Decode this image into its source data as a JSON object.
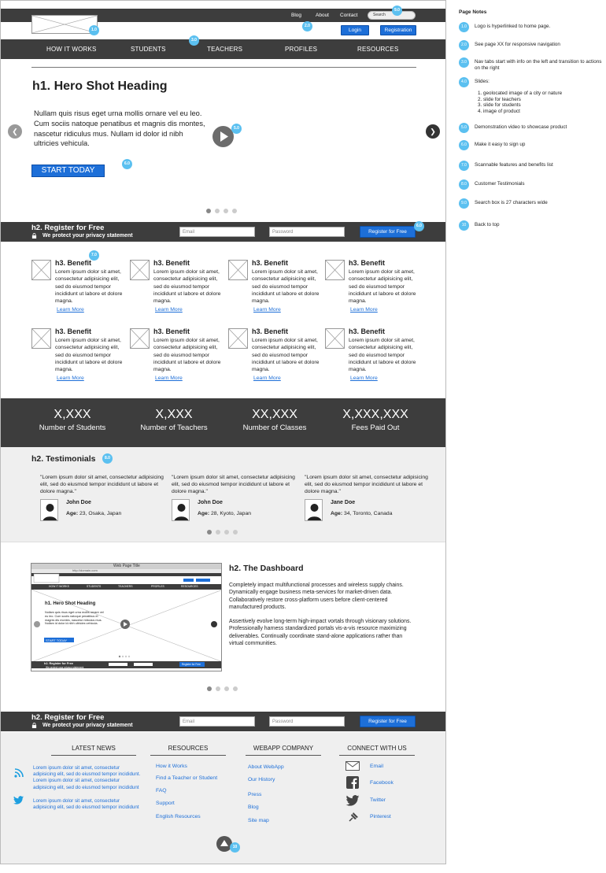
{
  "header": {
    "top_links": [
      "Blog",
      "About",
      "Contact"
    ],
    "search_placeholder": "Search",
    "login_label": "Login",
    "registration_label": "Registration",
    "nav_items": [
      "HOW IT WORKS",
      "STUDENTS",
      "TEACHERS",
      "PROFILES",
      "RESOURCES"
    ]
  },
  "badges": {
    "logo": "1.0",
    "search": "9.0",
    "nav": "3.0",
    "top": "2.0",
    "play": "5.0",
    "start": "6.0",
    "register": "6.0",
    "benefits": "7.0",
    "testimonials": "8.0",
    "backtop": "10"
  },
  "hero": {
    "heading": "h1. Hero Shot Heading",
    "body": "Nullam quis risus eget urna mollis ornare vel eu leo. Cum sociis natoque penatibus et magnis dis montes, nascetur ridiculus mus. Nullam id dolor id nibh ultricies vehicula.",
    "cta": "START TODAY"
  },
  "register": {
    "heading": "h2. Register for Free",
    "privacy": "We protect your privacy statement",
    "email_placeholder": "Email",
    "password_placeholder": "Password",
    "button": "Register for Free"
  },
  "benefits": {
    "title": "h3. Benefit",
    "text": "Lorem ipsum dolor sit amet, consectetur adipisicing elit, sed do eiusmod tempor incididunt ut labore et dolore magna.",
    "link": "Learn More"
  },
  "stats": [
    {
      "value": "X,XXX",
      "label": "Number of Students"
    },
    {
      "value": "X,XXX",
      "label": "Number of Teachers"
    },
    {
      "value": "XX,XXX",
      "label": "Number of Classes"
    },
    {
      "value": "X,XXX,XXX",
      "label": "Fees Paid Out"
    }
  ],
  "testimonials": {
    "heading": "h2. Testimonials",
    "quote": "\"Lorem ipsum dolor sit amet, consectetur adipisicing elit, sed do eiusmod tempor incididunt ut labore et dolore magna.\"",
    "people": [
      {
        "name": "John Doe",
        "age_label": "Age:",
        "age": "23, Osaka, Japan"
      },
      {
        "name": "John Doe",
        "age_label": "Age:",
        "age": "28, Kyoto, Japan"
      },
      {
        "name": "Jane Doe",
        "age_label": "Age:",
        "age": "34, Toronto, Canada"
      }
    ]
  },
  "dashboard": {
    "heading": "h2. The Dashboard",
    "p1": "Completely impact multifunctional processes and wireless supply chains. Dynamically engage business meta-services for market-driven data. Collaboratively restore cross-platform users before client-centered manufactured products.",
    "p2": "Assertively evolve long-term high-impact vortals through visionary solutions. Professionally harness standardized portals vis-a-vis resource maximizing deliverables. Continually coordinate stand-alone applications rather than virtual communities.",
    "mini_title": "Web Page Title",
    "mini_url": "http://domain.com",
    "mini_heading": "h1. Hero Shot Heading",
    "mini_body": "Nullam quis risus eget urna mollis ornare vel eu leo. Cum sociis natoque penatibus et magnis dis montes, nascetur ridiculus mus. Nullam id dolor id nibh ultricies vehicula.",
    "mini_cta": "START TODAY",
    "mini_nav": [
      "HOW IT WORKS",
      "STUDENTS",
      "TEACHERS",
      "PROFILES",
      "RESOURCES"
    ],
    "mini_register": "h2. Register for Free",
    "mini_privacy": "We protect your privacy statement",
    "mini_button": "Register for Free"
  },
  "footer": {
    "news_heading": "LATEST NEWS",
    "news_items": [
      "Lorem ipsum dolor sit amet, consectetur adipisicing elit, sed do eiusmod tempor incididunt. Lorem ipsum dolor sit amet, consectetur adipisicing elit, sed do eiusmod tempor incididunt",
      "Lorem ipsum dolor sit amet, consectetur adipisicing elit, sed do eiusmod tempor incididunt"
    ],
    "resources_heading": "RESOURCES",
    "resources": [
      "How it Works",
      "Find a Teacher or Student",
      "FAQ",
      "Support",
      "English Resources"
    ],
    "company_heading": "WEBAPP COMPANY",
    "company": [
      "About WebApp",
      "Our History",
      "Press",
      "Blog",
      "Site map"
    ],
    "connect_heading": "CONNECT WITH US",
    "connect": [
      "Email",
      "Facebook",
      "Twitter",
      "Pinterest"
    ]
  },
  "notes": {
    "title": "Page Notes",
    "items": [
      {
        "num": "1.0",
        "text": "Logo is hyperlinked to home page."
      },
      {
        "num": "2.0",
        "text": "See page XX for responsive navigation"
      },
      {
        "num": "3.0",
        "text": "Nav tabs start with info on the left and transition to actions on the right"
      },
      {
        "num": "4.0",
        "text": "Slides:"
      },
      {
        "num": "5.0",
        "text": "Demonstration video to showcase product"
      },
      {
        "num": "6.0",
        "text": "Make it easy to sign up"
      },
      {
        "num": "7.0",
        "text": "Scannable features and benefits list"
      },
      {
        "num": "8.0",
        "text": "Customer Testimonials"
      },
      {
        "num": "9.0",
        "text": "Search box is 27 characters wide"
      },
      {
        "num": "10",
        "text": "Back to top"
      }
    ],
    "slides": [
      "1. geolocated image of a city or nature",
      "2. slide for teachers",
      "3. slide for students",
      "4. image of product"
    ]
  }
}
